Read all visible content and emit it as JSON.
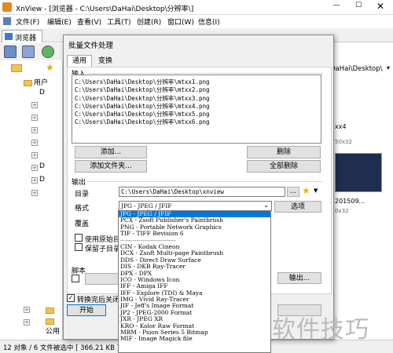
{
  "window": {
    "title": "XnView - [浏览器 - C:\\Users\\DaHai\\Desktop\\分辨率\\]"
  },
  "menu": [
    "文件(F)",
    "编辑(E)",
    "查看(V)",
    "工具(T)",
    "创建(R)",
    "窗口(W)",
    "信息(I)"
  ],
  "tabs": {
    "browser": "浏览器"
  },
  "tree": {
    "user": "用户",
    "d1": "D",
    "d2": "D",
    "d3": "D",
    "public": "公用"
  },
  "right_panel": {
    "path": "DaHai\\Desktop\\",
    "item1": "xx4",
    "item1b": "50x32",
    "item2": "201509...",
    "item2b": "0x32"
  },
  "dialog": {
    "title": "批量文件处理",
    "tab_general": "通用",
    "tab_convert": "变换",
    "input_label": "输入",
    "files": [
      "C:\\Users\\DaHai\\Desktop\\分辨率\\mtxx1.png",
      "C:\\Users\\DaHai\\Desktop\\分辨率\\mtxx2.png",
      "C:\\Users\\DaHai\\Desktop\\分辨率\\mtxx3.png",
      "C:\\Users\\DaHai\\Desktop\\分辨率\\mtxx4.png",
      "C:\\Users\\DaHai\\Desktop\\分辨率\\mtxx5.png",
      "C:\\Users\\DaHai\\Desktop\\分辨率\\mtxx6.png"
    ],
    "add": "添加...",
    "remove": "删除",
    "add_folder": "添加文件夹...",
    "remove_all": "全部删除",
    "output_label": "输出",
    "dir_label": "目录",
    "dir_value": "C:\\Users\\DaHai\\Desktop\\xnview",
    "browse": "...",
    "format_label": "格式",
    "format_value": "JPG - JPEG / JFIF",
    "options": "选项",
    "overwrite_label": "覆盖",
    "use_original_dir": "使用原始目录",
    "keep_subdir": "保留子目录结",
    "script_label": "脚本",
    "export": "输出...",
    "close_after": "转换完后关闭对",
    "start": "开始"
  },
  "formats": [
    "JPG - JPEG / JFIF",
    "PCX - Zsoft Publisher's Paintbrush",
    "PNG - Portable Network Graphics",
    "TIF - TIFF Revision 6",
    "----------------------------",
    "CIN - Kodak Cineon",
    "DCX - Zsoft Multi-page Paintbrush",
    "DDS - Direct Draw Surface",
    "DIS - DKB Ray-Tracer",
    "DPX - DPX",
    "ICO - Windows Icon",
    "IFF - Amiga IFF",
    "IFF - Explore (TDI) & Maya",
    "IMG - Vivid Ray-Tracer",
    "JIF - Jeff's Image Format",
    "JP2 - JPEG-2000 Format",
    "JXR - JPEG XR",
    "KRO - Kolor Raw Format",
    "MBM - Psion Series 5 Bitmap",
    "MIF - Image Magick file"
  ],
  "status": {
    "text": "12 对象 / 6 文件被选中  [ 366.21 KB ]"
  },
  "watermark": "软件技巧"
}
